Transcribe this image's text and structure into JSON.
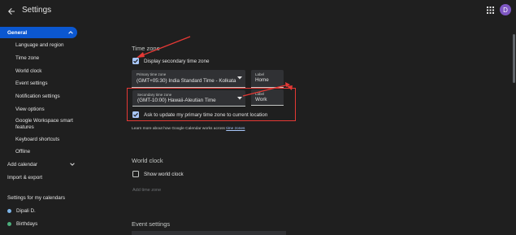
{
  "header": {
    "title": "Settings",
    "avatar_letter": "D",
    "avatar_color": "#7e57c2"
  },
  "sidebar": {
    "general_label": "General",
    "general_subitems": [
      "Language and region",
      "Time zone",
      "World clock",
      "Event settings",
      "Notification settings",
      "View options",
      "Google Workspace smart features",
      "Keyboard shortcuts",
      "Offline"
    ],
    "add_calendar_label": "Add calendar",
    "import_export_label": "Import & export",
    "my_calendars_heading": "Settings for my calendars",
    "calendars": [
      {
        "name": "Dipali D.",
        "color": "#7cb4e8"
      },
      {
        "name": "Birthdays",
        "color": "#4caf7d"
      }
    ]
  },
  "time_zone": {
    "title": "Time zone",
    "display_secondary_label": "Display secondary time zone",
    "display_secondary_checked": true,
    "primary": {
      "caption": "Primary time zone",
      "value": "(GMT+05:30) India Standard Time - Kolkata",
      "label_caption": "Label",
      "label_value": "Home"
    },
    "secondary": {
      "caption": "Secondary time zone",
      "value": "(GMT-10:00) Hawaii-Aleutian Time",
      "label_caption": "Label",
      "label_value": "Work"
    },
    "ask_update_label": "Ask to update my primary time zone to current location",
    "ask_update_checked": true,
    "learn_more_text": "Learn more about how Google Calendar works across",
    "learn_more_link": "time zones"
  },
  "world_clock": {
    "title": "World clock",
    "show_label": "Show world clock",
    "show_checked": false,
    "add_time_zone_label": "Add time zone"
  },
  "event_settings": {
    "title": "Event settings"
  },
  "colors": {
    "accent": "#0b57d0",
    "annotation": "#e53935",
    "checkbox": "#a8c7fa"
  }
}
